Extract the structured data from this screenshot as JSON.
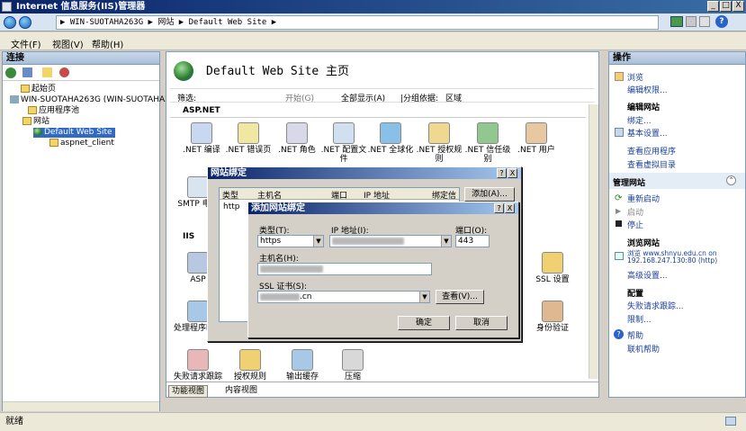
{
  "window": {
    "title": "Internet 信息服务(IIS)管理器",
    "min": "_",
    "max": "□",
    "close": "X"
  },
  "address": {
    "path": "▶ WIN-SUOTAHA263G ▶ 网站 ▶ Default Web Site ▶"
  },
  "menu": {
    "file": "文件(F)",
    "view": "视图(V)",
    "help": "帮助(H)"
  },
  "left": {
    "header": "连接",
    "tree": {
      "start": "起始页",
      "server": "WIN-SUOTAHA263G (WIN-SUOTAHA263G",
      "apppools": "应用程序池",
      "sites": "网站",
      "site": "Default Web Site",
      "child": "aspnet_client"
    }
  },
  "main": {
    "title": "Default Web Site 主页",
    "filter_label": "筛选:",
    "filter_start": "开始(G)",
    "filter_showall": "全部显示(A)",
    "group_label": "|分组依据:",
    "group_value": "区域",
    "section_asp": "ASP.NET",
    "section_iis": "IIS",
    "features_row1": [
      ".NET 编译",
      ".NET 错误页",
      ".NET 角色",
      ".NET 配置文件",
      ".NET 全球化",
      ".NET 授权规则",
      ".NET 信任级别",
      ".NET 用户"
    ],
    "smtp": "SMTP 电子",
    "asp": "ASP",
    "ssl": "SSL 设置",
    "handler": "处理程序映射",
    "err": "错",
    "auth": "身份验证",
    "features_row3": [
      "失败请求跟踪",
      "授权规则",
      "输出缓存",
      "压缩"
    ],
    "tab_features": "功能视图",
    "tab_content": "内容视图"
  },
  "bindings_dialog": {
    "title": "网站绑定",
    "help": "?",
    "close": "X",
    "col_type": "类型",
    "col_host": "主机名",
    "col_port": "端口",
    "col_ip": "IP 地址",
    "col_bind": "绑定信",
    "row_type": "http",
    "add": "添加(A)..."
  },
  "add_dialog": {
    "title": "添加网站绑定",
    "help": "?",
    "close": "X",
    "type_label": "类型(T):",
    "type_value": "https",
    "ip_label": "IP 地址(I):",
    "port_label": "端口(O):",
    "port_value": "443",
    "host_label": "主机名(H):",
    "ssl_label": "SSL 证书(S):",
    "ssl_suffix": ".cn",
    "view": "查看(V)...",
    "ok": "确定",
    "cancel": "取消"
  },
  "right": {
    "header": "操作",
    "browse": "浏览",
    "edit_perm": "编辑权限...",
    "edit_site": "编辑网站",
    "bind": "绑定...",
    "basic": "基本设置...",
    "view_apps": "查看应用程序",
    "view_vdirs": "查看虚拟目录",
    "manage": "管理网站",
    "restart": "重新启动",
    "start": "启动",
    "stop": "停止",
    "browse_site": "浏览网站",
    "browse_link1": "浏览 www.shnyu.edu.cn on",
    "browse_link2": "192.168.247.130:80 (http)",
    "advanced": "高级设置...",
    "config": "配置",
    "failed_req": "失败请求跟踪...",
    "limits": "限制...",
    "help": "帮助",
    "online_help": "联机帮助"
  },
  "status": {
    "text": "就绪"
  }
}
